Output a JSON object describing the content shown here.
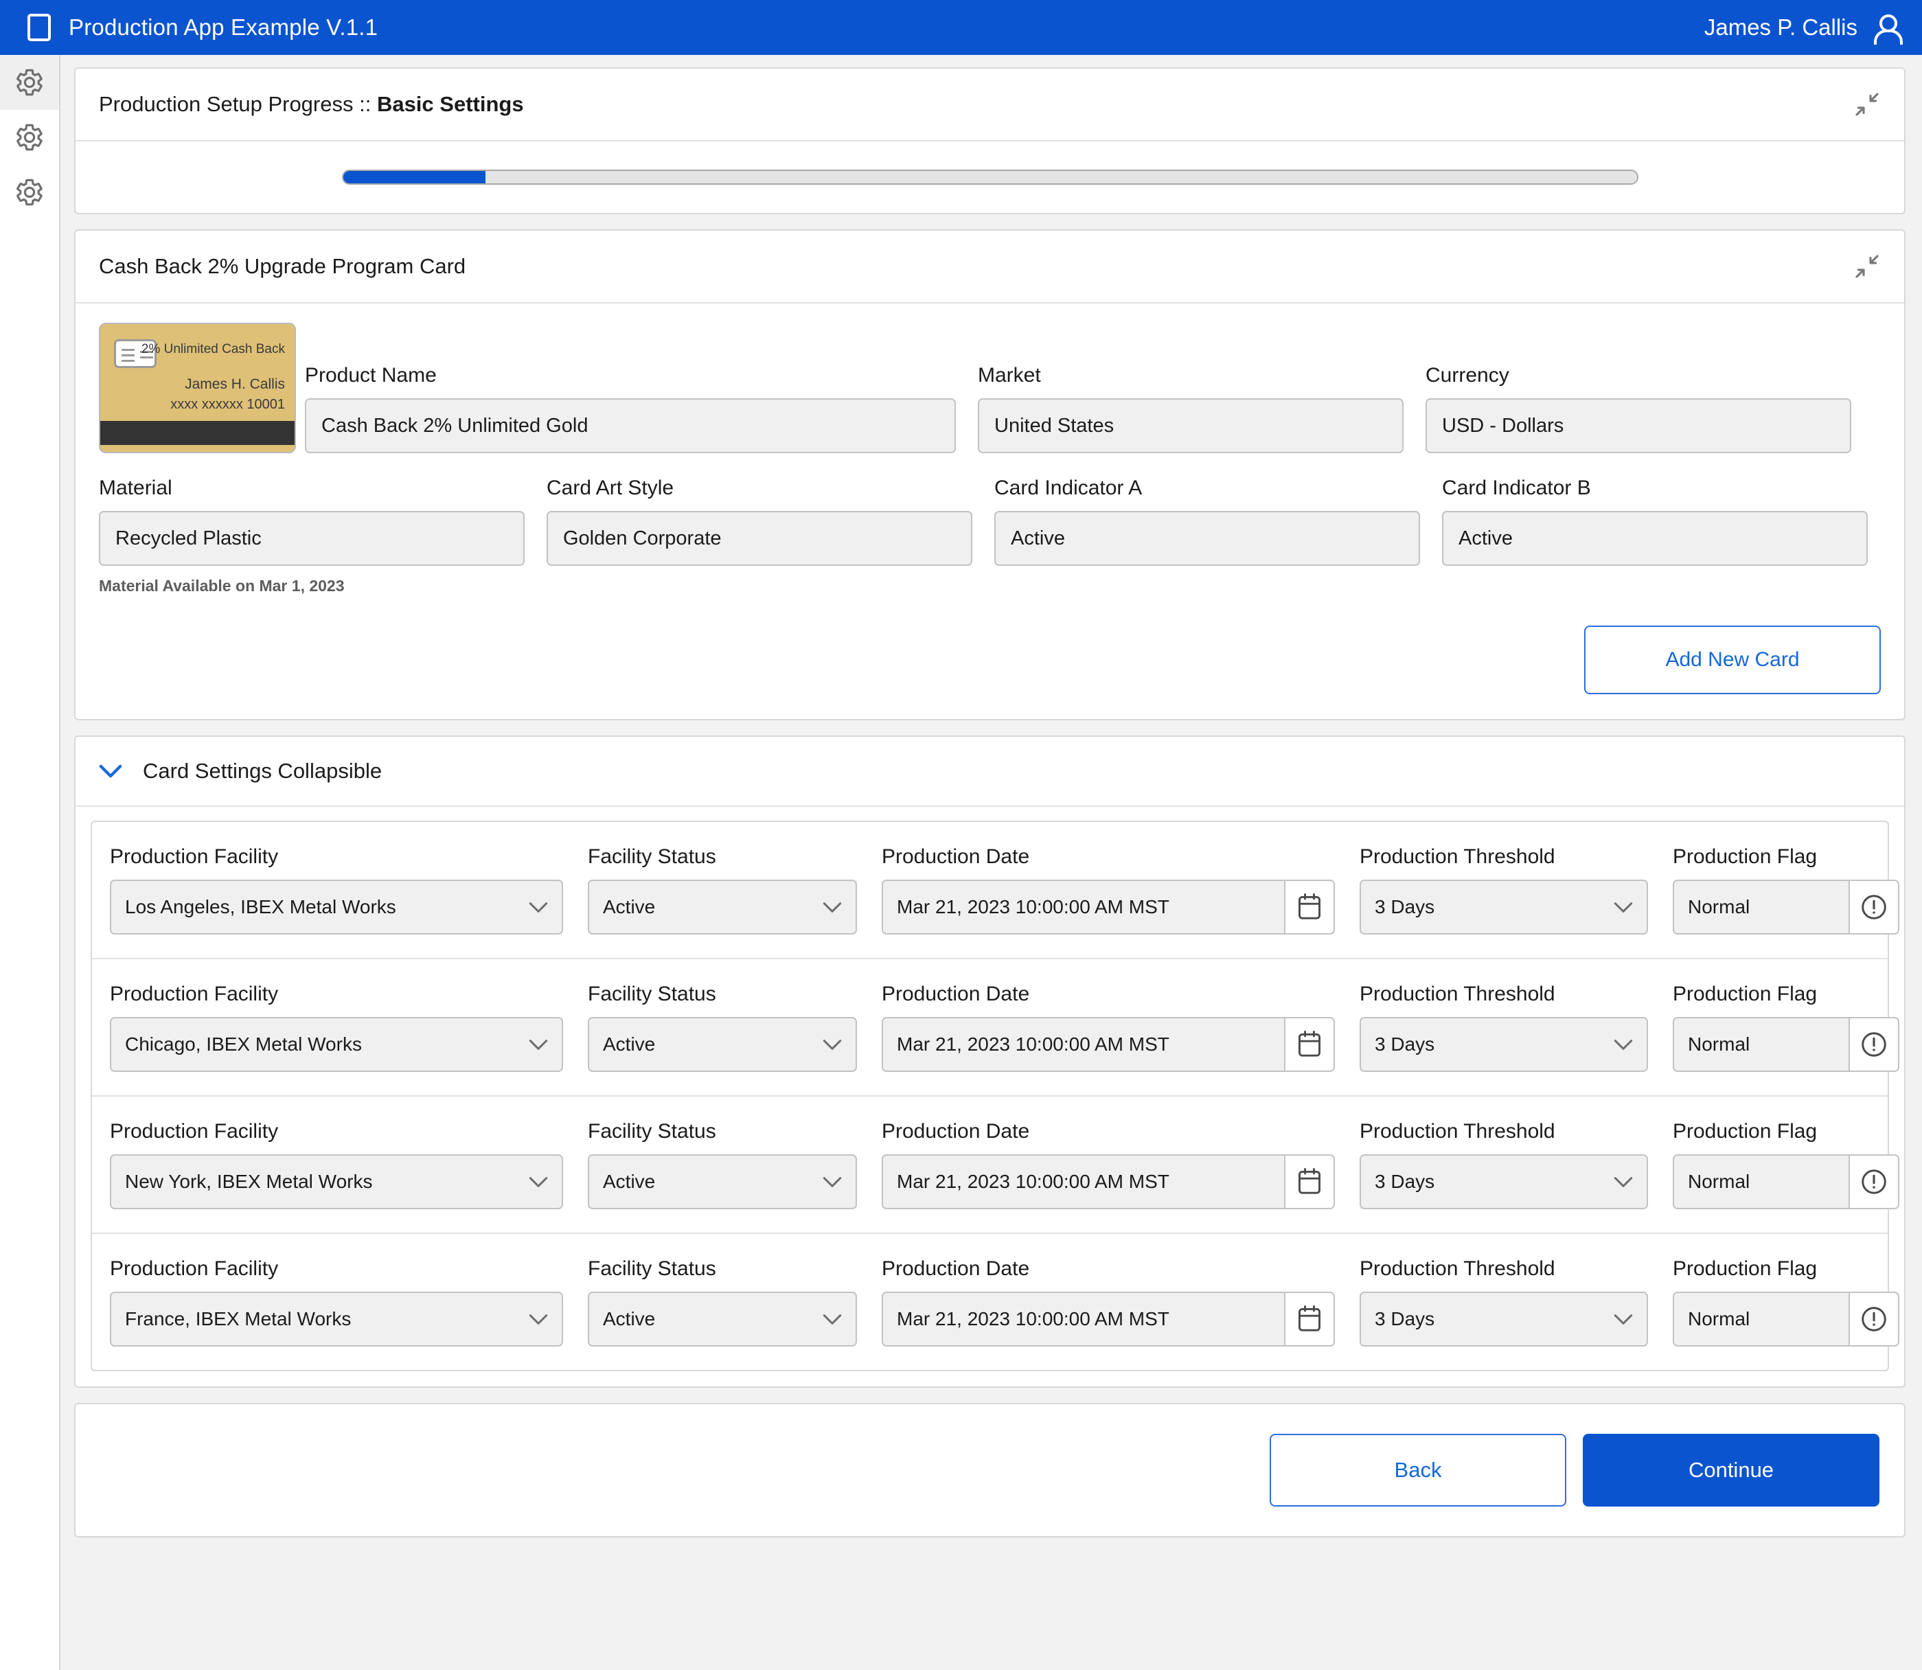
{
  "topbar": {
    "app_icon": "app-square-icon",
    "title": "Production App Example V.1.1",
    "user_name": "James P. Callis",
    "user_icon": "user-icon",
    "bg_color": "#0b54d0"
  },
  "sidebar": {
    "items": [
      {
        "icon": "gear-icon",
        "active": true
      },
      {
        "icon": "gear-icon",
        "active": false
      },
      {
        "icon": "gear-icon",
        "active": false
      }
    ]
  },
  "progress_panel": {
    "title_prefix": "Production Setup Progress :: ",
    "title_bold": "Basic Settings",
    "collapse_icon": "collapse-arrows-icon",
    "progress_percent": 11
  },
  "card_panel": {
    "title": "Cash Back 2% Upgrade Program Card",
    "collapse_icon": "collapse-arrows-icon",
    "card_art": {
      "chip_icon": "card-chip-icon",
      "program_label": "2% Unlimited Cash Back",
      "holder_name": "James H. Callis",
      "card_number": "xxxx xxxxxx 10001",
      "color": "#dfc077"
    },
    "fields": {
      "product_name": {
        "label": "Product Name",
        "value": "Cash Back 2% Unlimited Gold"
      },
      "market": {
        "label": "Market",
        "value": "United States"
      },
      "currency": {
        "label": "Currency",
        "value": "USD - Dollars"
      },
      "material": {
        "label": "Material",
        "value": "Recycled Plastic"
      },
      "card_art_style": {
        "label": "Card Art Style",
        "value": "Golden Corporate"
      },
      "card_indicator_a": {
        "label": "Card Indicator A",
        "value": "Active"
      },
      "card_indicator_b": {
        "label": "Card Indicator B",
        "value": "Active"
      }
    },
    "material_note": "Material Available on Mar 1, 2023",
    "add_card_label": "Add New Card"
  },
  "collapsible": {
    "chevron_icon": "chevron-down-icon",
    "title": "Card Settings Collapsible",
    "columns": {
      "facility": "Production Facility",
      "status": "Facility Status",
      "date": "Production Date",
      "threshold": "Production Threshold",
      "flag": "Production Flag"
    },
    "date_icon": "calendar-icon",
    "flag_icon": "exclamation-circle-icon",
    "dropdown_icon": "chevron-down-icon",
    "rows": [
      {
        "facility": "Los Angeles, IBEX Metal Works",
        "status": "Active",
        "date": "Mar 21, 2023 10:00:00 AM MST",
        "threshold": "3 Days",
        "flag": "Normal"
      },
      {
        "facility": "Chicago, IBEX Metal Works",
        "status": "Active",
        "date": "Mar 21, 2023 10:00:00 AM MST",
        "threshold": "3 Days",
        "flag": "Normal"
      },
      {
        "facility": "New York, IBEX Metal Works",
        "status": "Active",
        "date": "Mar 21, 2023 10:00:00 AM MST",
        "threshold": "3 Days",
        "flag": "Normal"
      },
      {
        "facility": "France, IBEX Metal Works",
        "status": "Active",
        "date": "Mar 21, 2023 10:00:00 AM MST",
        "threshold": "3 Days",
        "flag": "Normal"
      }
    ]
  },
  "footer": {
    "back_label": "Back",
    "continue_label": "Continue"
  },
  "colors": {
    "brand_blue": "#0b54d0",
    "link_blue": "#1468dd",
    "field_bg": "#f0f0f0",
    "card_gold": "#dfc077"
  }
}
